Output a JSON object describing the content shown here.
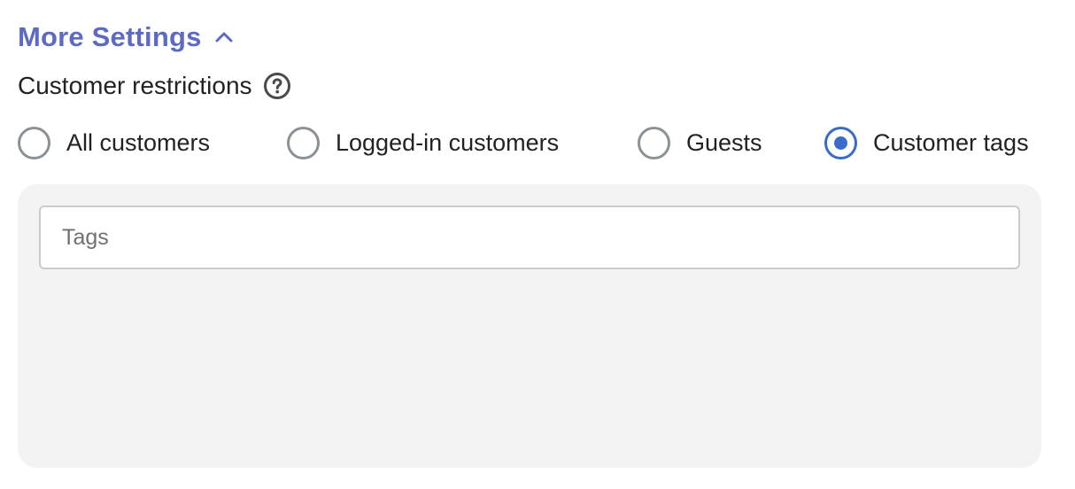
{
  "more_settings": {
    "label": "More Settings",
    "expanded": true,
    "icon": "chevron-up-icon",
    "color": "#5c6ac4"
  },
  "customer_restrictions": {
    "label": "Customer restrictions",
    "help_icon": "help-circle-icon",
    "options": [
      {
        "label": "All customers",
        "checked": false
      },
      {
        "label": "Logged-in customers",
        "checked": false
      },
      {
        "label": "Guests",
        "checked": false
      },
      {
        "label": "Customer tags",
        "checked": true
      }
    ],
    "selected_color": "#3a6bc9"
  },
  "tags": {
    "value": "",
    "placeholder": "Tags"
  }
}
